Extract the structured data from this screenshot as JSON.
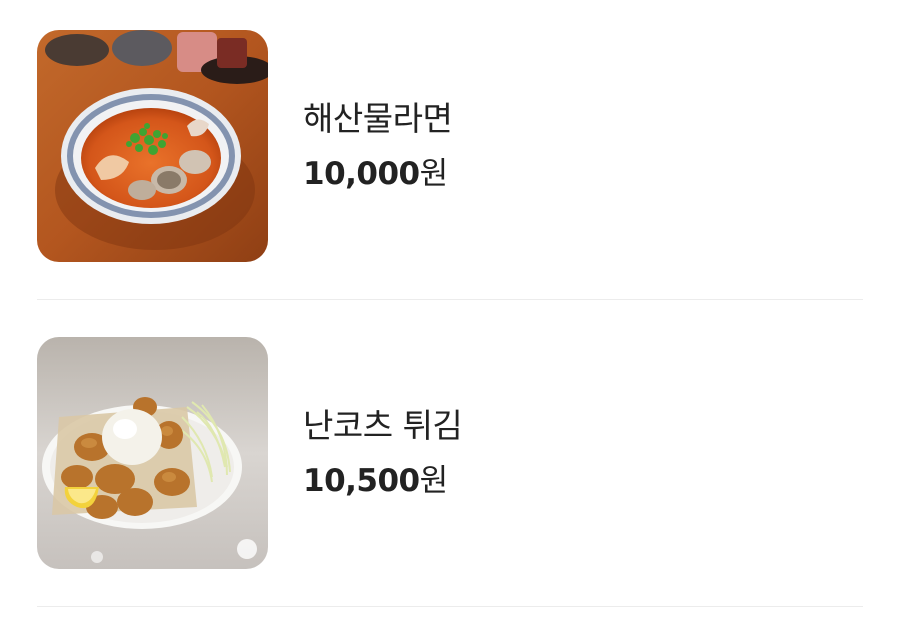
{
  "menu": {
    "items": [
      {
        "name": "해산물라면",
        "price": "10,000",
        "currency": "원",
        "image": "seafood-ramen-photo"
      },
      {
        "name": "난코츠 튀김",
        "price": "10,500",
        "currency": "원",
        "image": "fried-cartilage-photo"
      }
    ]
  }
}
